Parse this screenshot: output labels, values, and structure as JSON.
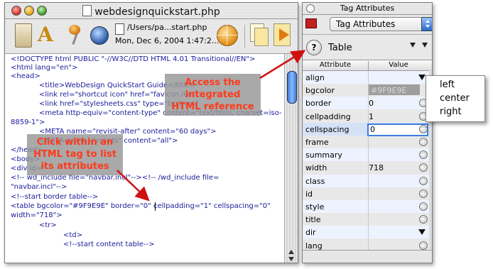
{
  "editor": {
    "title": "webdesignquickstart.php",
    "path": "/Users/pa...start.php",
    "date": "Mon, Dec 6, 2004 1:47:2...",
    "code_lines": [
      "<!DOCTYPE html PUBLIC \"-//W3C//DTD HTML 4.01 Transitional//EN\">",
      "<html lang=\"en\">",
      "<head>",
      "<title>WebDesign QuickStart Guide</title>",
      "<link rel=\"shortcut icon\" href=\"favicon.ico\" ...",
      "<link href=\"stylesheets.css\" type=\"text/css\" ...",
      "<meta http-equiv=\"content-type\" content=\"text/html; charset=iso-",
      "8859-1\">",
      "<META name=\"revisit-after\" content=\"60 days\">",
      "<META name=\"robots\" content=\"all\">",
      "</head>",
      "<body>",
      "<div id=\"",
      "<!-- wd_include file=\"navbar.incl\"--><!-- /wd_include file=",
      "\"navbar.incl\"-->",
      "<!--start border table-->",
      "<table bgcolor=\"#9F9E9E\" border=\"0\" cellpadding=\"1\" cellspacing=\"0\"",
      "width=\"718\">",
      "<tr>",
      "<td>",
      "<!--start content table-->"
    ]
  },
  "callouts": {
    "access": [
      "Access the",
      "integrated",
      "HTML reference"
    ],
    "click": [
      "Click within an",
      "HTML tag to list",
      "its attributes"
    ]
  },
  "palette": {
    "title": "Tag Attributes",
    "mode": "Tag Attributes",
    "help": "?",
    "tag": "Table",
    "col_attribute": "Attribute",
    "col_value": "Value",
    "attributes": [
      {
        "name": "align",
        "value": "",
        "control": "dropdown"
      },
      {
        "name": "bgcolor",
        "value": "#9F9E9E",
        "control": "color"
      },
      {
        "name": "border",
        "value": "0",
        "control": "ellipsis"
      },
      {
        "name": "cellpadding",
        "value": "1",
        "control": "ellipsis"
      },
      {
        "name": "cellspacing",
        "value": "0",
        "control": "editing"
      },
      {
        "name": "frame",
        "value": "",
        "control": "ellipsis"
      },
      {
        "name": "summary",
        "value": "",
        "control": "ellipsis"
      },
      {
        "name": "width",
        "value": "718",
        "control": "ellipsis"
      },
      {
        "name": "class",
        "value": "",
        "control": "ellipsis"
      },
      {
        "name": "id",
        "value": "",
        "control": "ellipsis"
      },
      {
        "name": "style",
        "value": "",
        "control": "ellipsis"
      },
      {
        "name": "title",
        "value": "",
        "control": "ellipsis"
      },
      {
        "name": "dir",
        "value": "",
        "control": "dropdown"
      },
      {
        "name": "lang",
        "value": "",
        "control": "ellipsis"
      }
    ]
  },
  "align_menu": [
    "left",
    "center",
    "right"
  ],
  "colors": {
    "callout_text": "#ff3a1a",
    "arrow": "#d01010",
    "code_text": "#1a1a9a",
    "selection": "#3a7ce0"
  }
}
